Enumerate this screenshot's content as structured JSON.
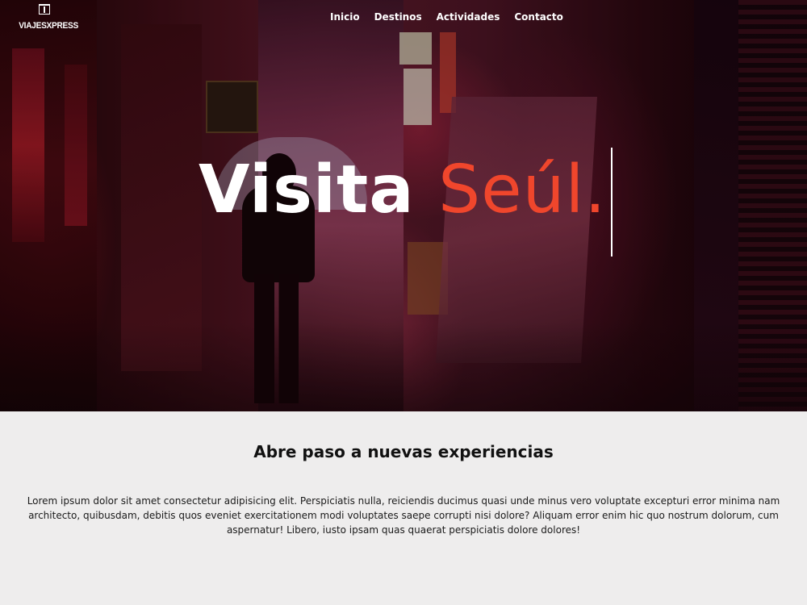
{
  "brand": {
    "logo_text": "VIAJESXPRESS"
  },
  "nav": {
    "items": [
      "Inicio",
      "Destinos",
      "Actividades",
      "Contacto"
    ]
  },
  "hero": {
    "title_part1": "Visita ",
    "title_part2": "Seúl."
  },
  "section": {
    "title": "Abre paso a nuevas experiencias",
    "body": "Lorem ipsum dolor sit amet consectetur adipisicing elit. Perspiciatis nulla, reiciendis ducimus quasi unde minus vero voluptate excepturi error minima nam architecto, quibusdam, debitis quos eveniet exercitationem modi voluptates saepe corrupti nisi dolore? Aliquam error enim hic quo nostrum dolorum, cum aspernatur! Libero, iusto ipsam quas quaerat perspiciatis dolore dolores!"
  },
  "colors": {
    "accent": "#f0462c",
    "page_background": "#eeeded"
  }
}
